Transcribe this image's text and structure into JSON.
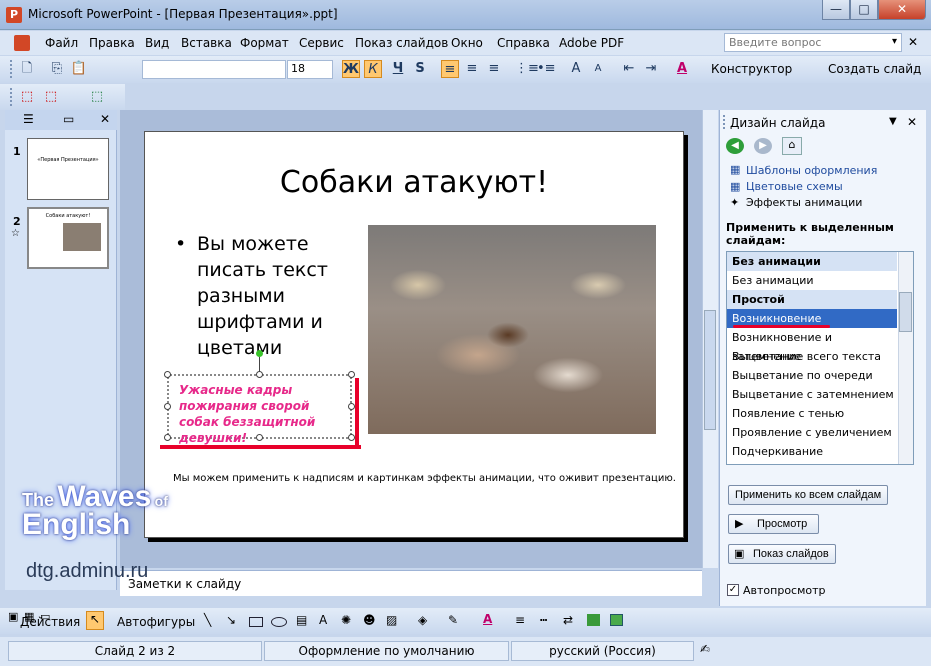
{
  "window": {
    "title": "Microsoft PowerPoint - [Первая Презентация».ppt]",
    "min": "—",
    "max": "□",
    "close": "✕"
  },
  "menu": [
    "Файл",
    "Правка",
    "Вид",
    "Вставка",
    "Формат",
    "Сервис",
    "Показ слайдов",
    "Окно",
    "Справка",
    "Adobe PDF"
  ],
  "help": {
    "placeholder": "Введите вопрос"
  },
  "toolbar": {
    "font_size": "18",
    "bold": "Ж",
    "italic": "К",
    "underline": "Ч",
    "shadow": "S",
    "designer": "Конструктор",
    "new_slide": "Создать слайд"
  },
  "thumbs": {
    "slide1_num": "1",
    "slide2_num": "2",
    "slide1_title": "«Первая Презентация»",
    "slide2_title": "Собаки атакуют!"
  },
  "slide": {
    "title": "Собаки атакуют!",
    "bullet_lines": [
      "Вы можете",
      "писать текст",
      "разными",
      "шрифтами и",
      "цветами"
    ],
    "caption": "Ужасные кадры пожирания сворой собак беззащитной девушки!",
    "note": "Мы можем применить к надписям и картинкам эффекты анимации, что оживит презентацию."
  },
  "notes": {
    "text": "Заметки к слайду"
  },
  "pane": {
    "title": "Дизайн слайда",
    "links": [
      "Шаблоны оформления",
      "Цветовые схемы",
      "Эффекты анимации"
    ],
    "apply_label": "Применить к выделенным слайдам:",
    "items": [
      {
        "t": "Без анимации",
        "type": "hd"
      },
      {
        "t": "Без анимации",
        "type": "n"
      },
      {
        "t": "Простой",
        "type": "hd"
      },
      {
        "t": "Возникновение",
        "type": "sel"
      },
      {
        "t": "Возникновение и затемнение",
        "type": "n"
      },
      {
        "t": "Выцветание всего текста",
        "type": "n"
      },
      {
        "t": "Выцветание по очереди",
        "type": "n"
      },
      {
        "t": "Выцветание с затемнением",
        "type": "n"
      },
      {
        "t": "Появление с тенью",
        "type": "n"
      },
      {
        "t": "Проявление с увеличением",
        "type": "n"
      },
      {
        "t": "Подчеркивание",
        "type": "n"
      }
    ],
    "apply_all": "Применить ко всем слайдам",
    "preview": "Просмотр",
    "slideshow": "Показ слайдов",
    "autopreview": "Автопросмотр"
  },
  "drawbar": {
    "actions": "Действия",
    "autoshapes": "Автофигуры"
  },
  "status": {
    "slide": "Слайд 2 из 2",
    "design": "Оформление по умолчанию",
    "lang": "русский (Россия)"
  },
  "watermark": {
    "line1a": "The",
    "line1b": "Waves",
    "line1c": "of",
    "line2": "English",
    "site": "dtg.adminu.ru"
  },
  "colors": {
    "selection": "#316ac5",
    "caption": "#e7298a",
    "annotation": "#e8002a"
  }
}
